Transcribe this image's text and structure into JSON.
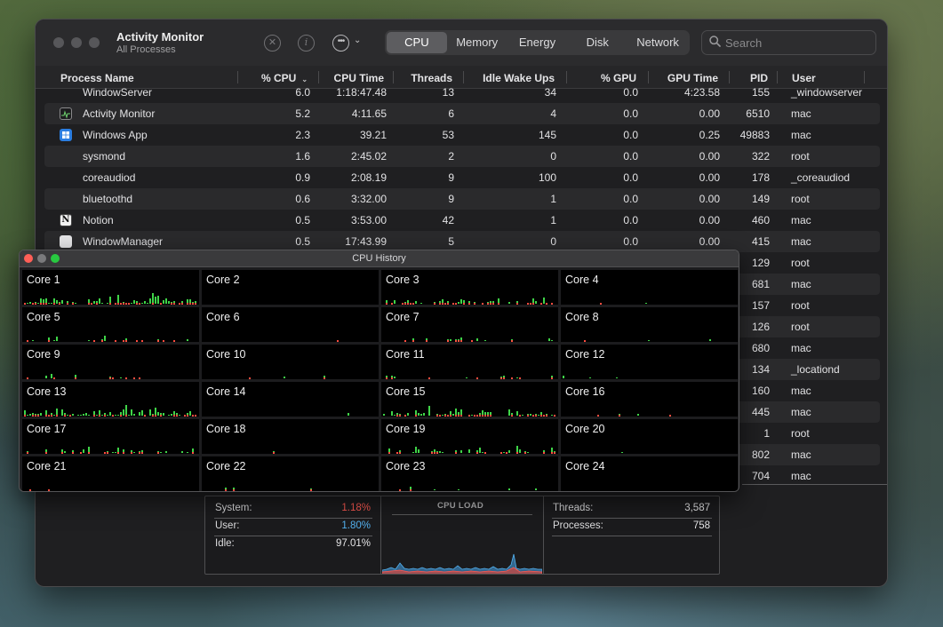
{
  "window": {
    "title": "Activity Monitor",
    "subtitle": "All Processes",
    "icons": [
      "stop-icon",
      "info-icon",
      "ellipsis-icon",
      "chevron-down-icon"
    ],
    "tabs": [
      "CPU",
      "Memory",
      "Energy",
      "Disk",
      "Network"
    ],
    "active_tab": "CPU",
    "search_placeholder": "Search"
  },
  "table": {
    "columns": [
      "Process Name",
      "% CPU",
      "CPU Time",
      "Threads",
      "Idle Wake Ups",
      "% GPU",
      "GPU Time",
      "PID",
      "User"
    ],
    "sort_column": "% CPU",
    "rows": [
      {
        "name": "WindowServer",
        "cpu": "6.0",
        "cpu_time": "1:18:47.48",
        "threads": "13",
        "idle_wake": "34",
        "gpu": "0.0",
        "gpu_time": "4:23.58",
        "pid": "155",
        "user": "_windowserver",
        "icon": ""
      },
      {
        "name": "Activity Monitor",
        "cpu": "5.2",
        "cpu_time": "4:11.65",
        "threads": "6",
        "idle_wake": "4",
        "gpu": "0.0",
        "gpu_time": "0.00",
        "pid": "6510",
        "user": "mac",
        "icon": "activity-monitor-icon"
      },
      {
        "name": "Windows App",
        "cpu": "2.3",
        "cpu_time": "39.21",
        "threads": "53",
        "idle_wake": "145",
        "gpu": "0.0",
        "gpu_time": "0.25",
        "pid": "49883",
        "user": "mac",
        "icon": "windows-app-icon"
      },
      {
        "name": "sysmond",
        "cpu": "1.6",
        "cpu_time": "2:45.02",
        "threads": "2",
        "idle_wake": "0",
        "gpu": "0.0",
        "gpu_time": "0.00",
        "pid": "322",
        "user": "root",
        "icon": ""
      },
      {
        "name": "coreaudiod",
        "cpu": "0.9",
        "cpu_time": "2:08.19",
        "threads": "9",
        "idle_wake": "100",
        "gpu": "0.0",
        "gpu_time": "0.00",
        "pid": "178",
        "user": "_coreaudiod",
        "icon": ""
      },
      {
        "name": "bluetoothd",
        "cpu": "0.6",
        "cpu_time": "3:32.00",
        "threads": "9",
        "idle_wake": "1",
        "gpu": "0.0",
        "gpu_time": "0.00",
        "pid": "149",
        "user": "root",
        "icon": ""
      },
      {
        "name": "Notion",
        "cpu": "0.5",
        "cpu_time": "3:53.00",
        "threads": "42",
        "idle_wake": "1",
        "gpu": "0.0",
        "gpu_time": "0.00",
        "pid": "460",
        "user": "mac",
        "icon": "notion-icon"
      },
      {
        "name": "WindowManager",
        "cpu": "0.5",
        "cpu_time": "17:43.99",
        "threads": "5",
        "idle_wake": "0",
        "gpu": "0.0",
        "gpu_time": "0.00",
        "pid": "415",
        "user": "mac",
        "icon": "window-manager-icon"
      },
      {
        "pid": "129",
        "user": "root"
      },
      {
        "pid": "681",
        "user": "mac"
      },
      {
        "pid": "157",
        "user": "root"
      },
      {
        "pid": "126",
        "user": "root"
      },
      {
        "pid": "680",
        "user": "mac"
      },
      {
        "pid": "134",
        "user": "_locationd"
      },
      {
        "pid": "160",
        "user": "mac"
      },
      {
        "pid": "445",
        "user": "mac"
      },
      {
        "pid": "1",
        "user": "root"
      },
      {
        "pid": "802",
        "user": "mac"
      },
      {
        "pid": "704",
        "user": "mac"
      }
    ]
  },
  "stats": {
    "system_label": "System:",
    "system_value": "1.18%",
    "user_label": "User:",
    "user_value": "1.80%",
    "idle_label": "Idle:",
    "idle_value": "97.01%",
    "load_title": "CPU LOAD",
    "threads_label": "Threads:",
    "threads_value": "3,587",
    "processes_label": "Processes:",
    "processes_value": "758",
    "colors": {
      "system": "#ff5a52",
      "user": "#54b2f0"
    }
  },
  "cpu_history": {
    "title": "CPU History",
    "cores": [
      "Core 1",
      "Core 2",
      "Core 3",
      "Core 4",
      "Core 5",
      "Core 6",
      "Core 7",
      "Core 8",
      "Core 9",
      "Core 10",
      "Core 11",
      "Core 12",
      "Core 13",
      "Core 14",
      "Core 15",
      "Core 16",
      "Core 17",
      "Core 18",
      "Core 19",
      "Core 20",
      "Core 21",
      "Core 22",
      "Core 23",
      "Core 24"
    ],
    "colors": {
      "user": "#3fd448",
      "system": "#ff4b3e"
    }
  }
}
